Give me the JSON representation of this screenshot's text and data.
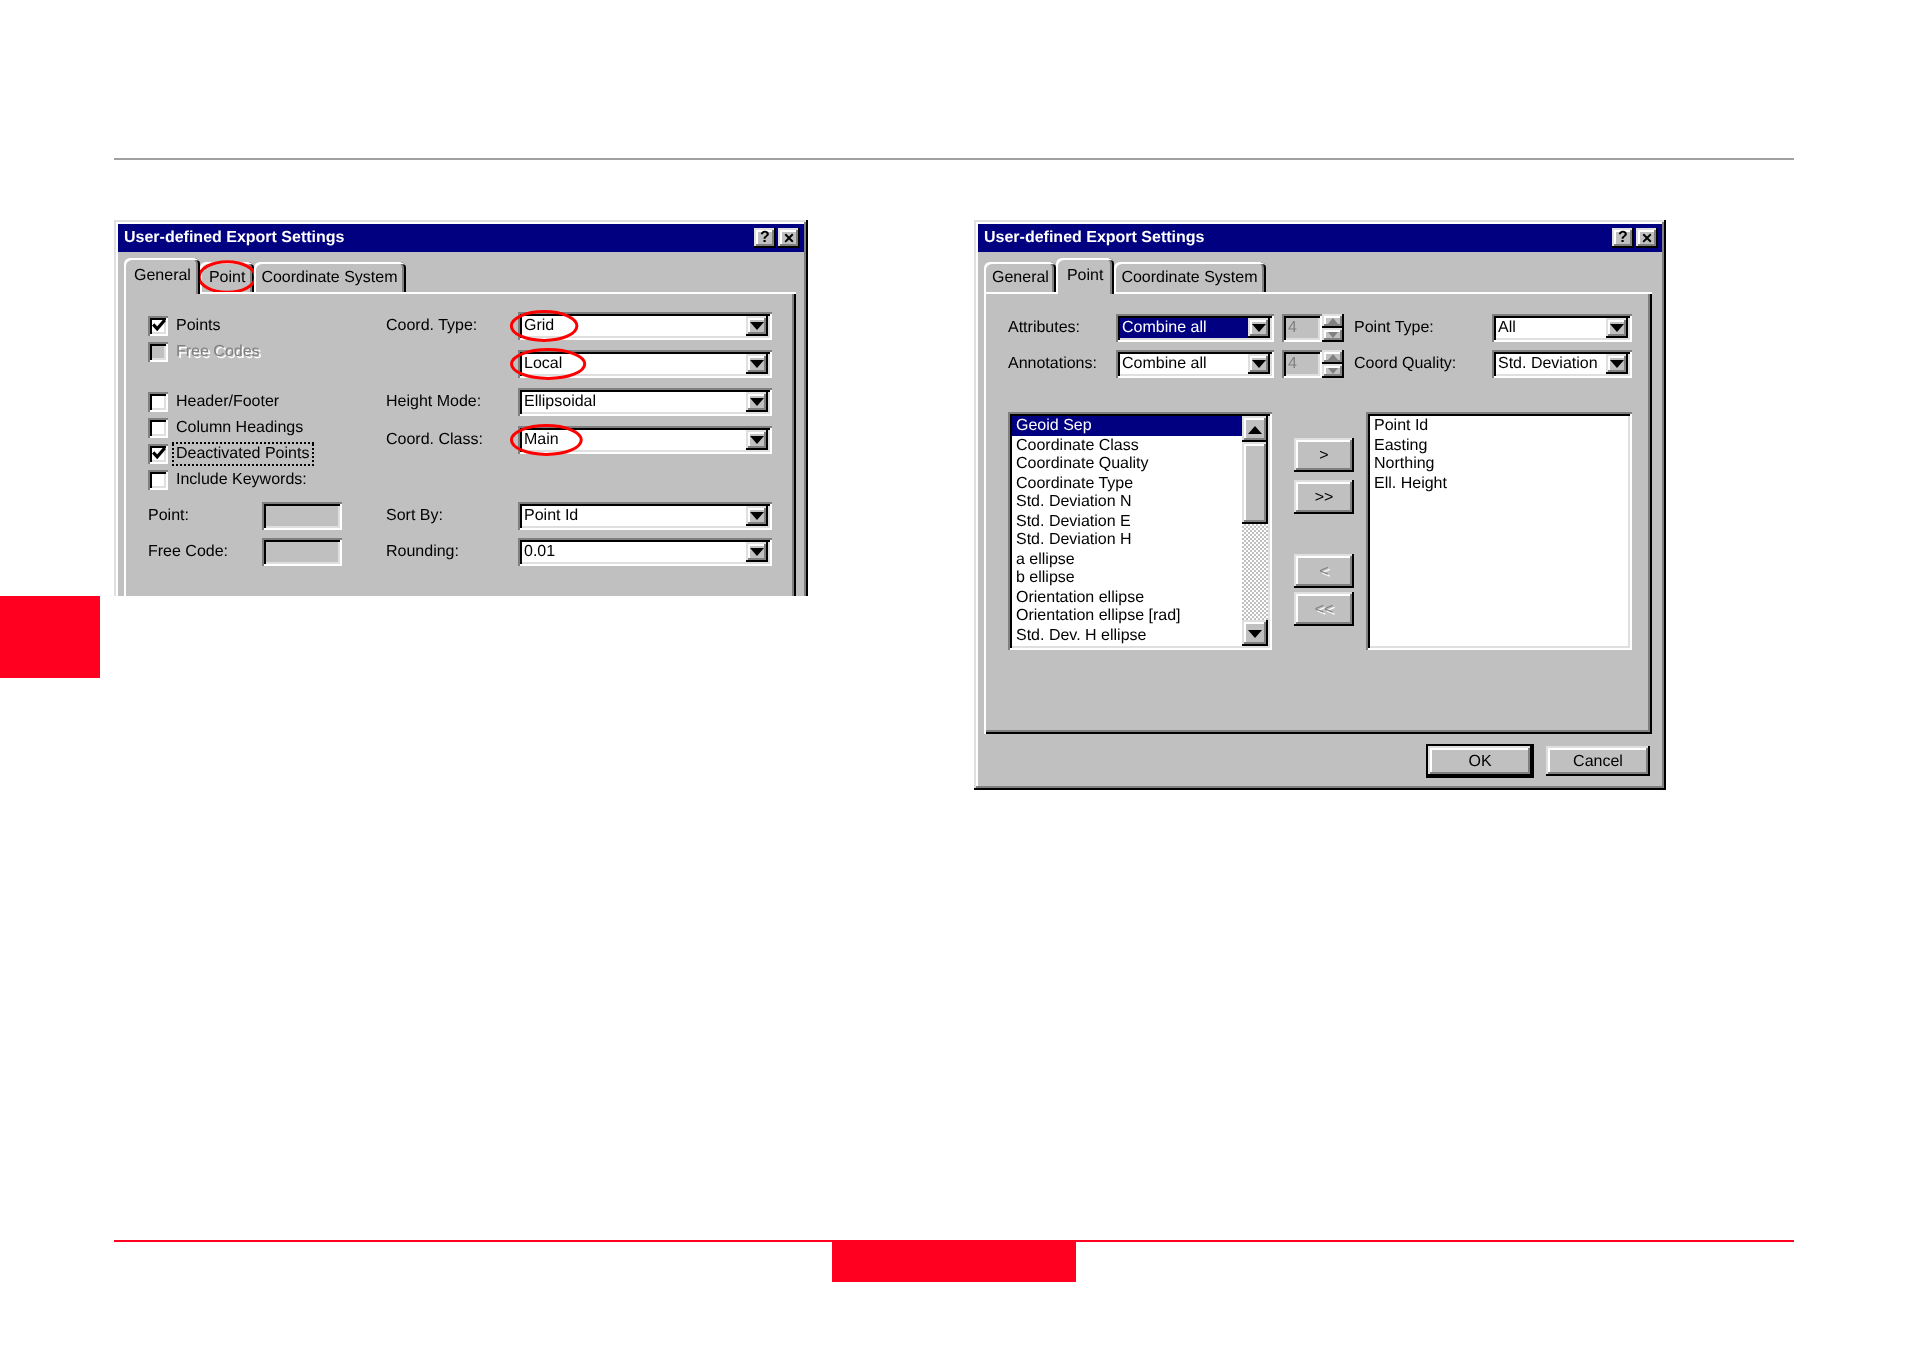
{
  "export_dialogs": [
    {
      "kind": "general",
      "title": "User-defined Export Settings",
      "help_button": "?",
      "close_button": "×",
      "tabs": [
        {
          "label": "General",
          "selected": true,
          "circled": false
        },
        {
          "label": "Point",
          "selected": false,
          "circled": true
        },
        {
          "label": "Coordinate System",
          "selected": false,
          "circled": false
        }
      ],
      "checkbox_groups": [
        {
          "items": [
            {
              "label": "Points",
              "checked": true,
              "disabled": false,
              "focused": false
            },
            {
              "label": "Free Codes",
              "checked": false,
              "disabled": true,
              "focused": false
            }
          ]
        },
        {
          "items": [
            {
              "label": "Header/Footer",
              "checked": false,
              "disabled": false,
              "focused": false
            },
            {
              "label": "Column Headings",
              "checked": false,
              "disabled": false,
              "focused": false
            },
            {
              "label": "Deactivated Points",
              "checked": true,
              "disabled": false,
              "focused": true
            },
            {
              "label": "Include Keywords:",
              "checked": false,
              "disabled": false,
              "focused": false
            }
          ]
        }
      ],
      "fields": [
        {
          "label": "Point:",
          "disabled": true
        },
        {
          "label": "Free Code:",
          "disabled": true
        }
      ],
      "dropdown_groups": [
        {
          "rows": [
            {
              "label": "Coord. Type:",
              "value": "Grid",
              "circled": true
            },
            {
              "value": "Local",
              "circled": true
            },
            {
              "label": "Height Mode:",
              "value": "Ellipsoidal",
              "circled": false
            },
            {
              "label": "Coord. Class:",
              "value": "Main",
              "circled": true
            }
          ]
        },
        {
          "rows": [
            {
              "label": "Sort By:",
              "value": "Point Id",
              "circled": false
            },
            {
              "label": "Rounding:",
              "value": "0.01",
              "circled": false
            }
          ]
        }
      ]
    },
    {
      "kind": "point",
      "title": "User-defined Export Settings",
      "help_button": "?",
      "close_button": "×",
      "tabs": [
        {
          "label": "General",
          "selected": false
        },
        {
          "label": "Point",
          "selected": true
        },
        {
          "label": "Coordinate System",
          "selected": false
        }
      ],
      "option_rows": [
        {
          "label": "Attributes:",
          "value": "Combine all",
          "focused": true,
          "count": "4",
          "count_disabled": true,
          "filter_label": "Point Type:",
          "filter_value": "All"
        },
        {
          "label": "Annotations:",
          "value": "Combine all",
          "focused": false,
          "count": "4",
          "count_disabled": true,
          "filter_label": "Coord Quality:",
          "filter_value": "Std. Deviation"
        }
      ],
      "available_list": {
        "items": [
          {
            "label": "Geoid Sep",
            "selected": true
          },
          {
            "label": "Coordinate Class",
            "selected": false
          },
          {
            "label": "Coordinate Quality",
            "selected": false
          },
          {
            "label": "Coordinate Type",
            "selected": false
          },
          {
            "label": "Std. Deviation N",
            "selected": false
          },
          {
            "label": "Std. Deviation E",
            "selected": false
          },
          {
            "label": "Std. Deviation H",
            "selected": false
          },
          {
            "label": "a ellipse",
            "selected": false
          },
          {
            "label": "b ellipse",
            "selected": false
          },
          {
            "label": "Orientation ellipse",
            "selected": false
          },
          {
            "label": "Orientation ellipse [rad]",
            "selected": false
          },
          {
            "label": "Std. Dev. H ellipse",
            "selected": false
          }
        ]
      },
      "transfer_button_groups": [
        {
          "buttons": [
            {
              "label": ">",
              "disabled": false
            },
            {
              "label": ">>",
              "disabled": false
            }
          ]
        },
        {
          "buttons": [
            {
              "label": "<",
              "disabled": true
            },
            {
              "label": "<<",
              "disabled": true
            }
          ]
        }
      ],
      "chosen_list": {
        "items": [
          {
            "label": "Point Id",
            "selected": false
          },
          {
            "label": "Easting",
            "selected": false
          },
          {
            "label": "Northing",
            "selected": false
          },
          {
            "label": "Ell. Height",
            "selected": false
          }
        ]
      },
      "buttons": [
        {
          "label": "OK",
          "default": true
        },
        {
          "label": "Cancel",
          "default": false
        }
      ]
    }
  ]
}
